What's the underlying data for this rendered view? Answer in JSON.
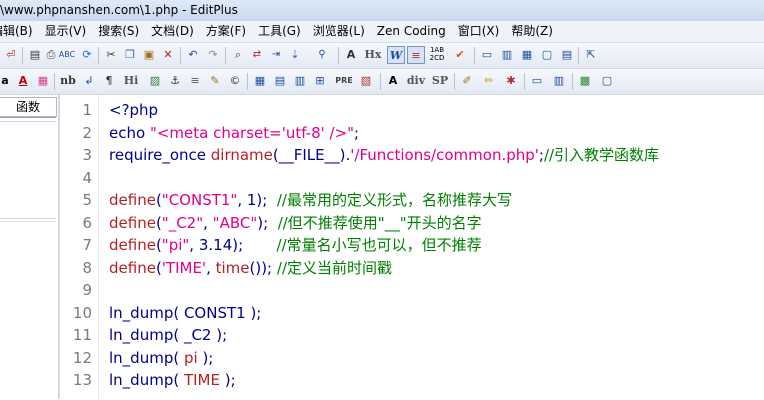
{
  "window": {
    "title": "\\www.phpnanshen.com\\1.php - EditPlus"
  },
  "menu": [
    "编辑(B)",
    "显示(V)",
    "搜索(S)",
    "文档(D)",
    "方案(F)",
    "工具(G)",
    "浏览器(L)",
    "Zen Coding",
    "窗口(X)",
    "帮助(Z)"
  ],
  "sidebar": {
    "tab_label": "函数"
  },
  "editor": {
    "line_numbers": [
      "1",
      "2",
      "3",
      "4",
      "5",
      "6",
      "7",
      "8",
      "9",
      "10",
      "11",
      "12",
      "13"
    ],
    "lines": [
      [
        {
          "t": "<?php",
          "c": "kw"
        }
      ],
      [
        {
          "t": "echo ",
          "c": "kw"
        },
        {
          "t": "\"<meta charset='utf-8' />\"",
          "c": "str"
        },
        {
          "t": ";",
          "c": "kw"
        }
      ],
      [
        {
          "t": "require_once ",
          "c": "kw"
        },
        {
          "t": "dirname",
          "c": "fn"
        },
        {
          "t": "(__FILE__).",
          "c": "kw"
        },
        {
          "t": "'/Functions/common.php'",
          "c": "str"
        },
        {
          "t": ";",
          "c": "kw"
        },
        {
          "t": "//引入教学函数库",
          "c": "cmt"
        }
      ],
      [],
      [
        {
          "t": "define",
          "c": "fn"
        },
        {
          "t": "(",
          "c": "kw"
        },
        {
          "t": "\"CONST1\"",
          "c": "str"
        },
        {
          "t": ", 1);  ",
          "c": "kw"
        },
        {
          "t": "//最常用的定义形式，名称推荐大写",
          "c": "cmt"
        }
      ],
      [
        {
          "t": "define",
          "c": "fn"
        },
        {
          "t": "(",
          "c": "kw"
        },
        {
          "t": "\"_C2\"",
          "c": "str"
        },
        {
          "t": ", ",
          "c": "kw"
        },
        {
          "t": "\"ABC\"",
          "c": "str"
        },
        {
          "t": ");  ",
          "c": "kw"
        },
        {
          "t": "//但不推荐使用\"__\"开头的名字",
          "c": "cmt"
        }
      ],
      [
        {
          "t": "define",
          "c": "fn"
        },
        {
          "t": "(",
          "c": "kw"
        },
        {
          "t": "\"pi\"",
          "c": "str"
        },
        {
          "t": ", 3.14);       ",
          "c": "kw"
        },
        {
          "t": "//常量名小写也可以，但不推荐",
          "c": "cmt"
        }
      ],
      [
        {
          "t": "define",
          "c": "fn"
        },
        {
          "t": "(",
          "c": "kw"
        },
        {
          "t": "'TIME'",
          "c": "str"
        },
        {
          "t": ", ",
          "c": "kw"
        },
        {
          "t": "time",
          "c": "fn"
        },
        {
          "t": "()); ",
          "c": "kw"
        },
        {
          "t": "//定义当前时间戳",
          "c": "cmt"
        }
      ],
      [],
      [
        {
          "t": "ln_dump( CONST1 );",
          "c": "kw"
        }
      ],
      [
        {
          "t": "ln_dump( _C2 );",
          "c": "kw"
        }
      ],
      [
        {
          "t": "ln_dump( ",
          "c": "kw"
        },
        {
          "t": "pi",
          "c": "fn"
        },
        {
          "t": " );",
          "c": "kw"
        }
      ],
      [
        {
          "t": "ln_dump( ",
          "c": "kw"
        },
        {
          "t": "TIME",
          "c": "fn"
        },
        {
          "t": " );",
          "c": "kw"
        }
      ]
    ]
  },
  "toolbar1": {
    "icons": [
      "undo-arrow-icon",
      "window-icon",
      "save-icon",
      "print-icon",
      "spellcheck-icon",
      "refresh-icon",
      "cut-icon",
      "copy-icon",
      "paste-icon",
      "delete-icon",
      "undo-icon",
      "redo-icon",
      "find-icon",
      "find-replace-icon",
      "find-next-icon",
      "goto-icon",
      "font-size-icon",
      "hex-icon",
      "word-wrap-icon",
      "line-number-icon",
      "sort-icon",
      "check-icon",
      "window-icon",
      "window-icon",
      "window-icon",
      "window-icon",
      "help-icon"
    ],
    "text_buttons": {
      "hx": "Hx"
    }
  },
  "toolbar2": {
    "icons": [
      "bold-icon",
      "font-color-icon",
      "color-palette-icon",
      "nb-icon",
      "line-break-icon",
      "paragraph-icon",
      "heading-icon",
      "image-icon",
      "anchor-icon",
      "hr-icon",
      "edit-icon",
      "copyright-icon",
      "table-icon",
      "table-row-icon",
      "table-col-icon",
      "pre-icon",
      "comment-icon",
      "form-icon",
      "div-icon",
      "span-icon",
      "pen-icon",
      "brush-icon",
      "tools-icon",
      "window-icon",
      "window-icon",
      "color-icon",
      "window-icon"
    ],
    "text_buttons": {
      "nb": "nb",
      "hi": "Hi",
      "pre": "PRE",
      "div": "div",
      "sp": "SP"
    }
  }
}
